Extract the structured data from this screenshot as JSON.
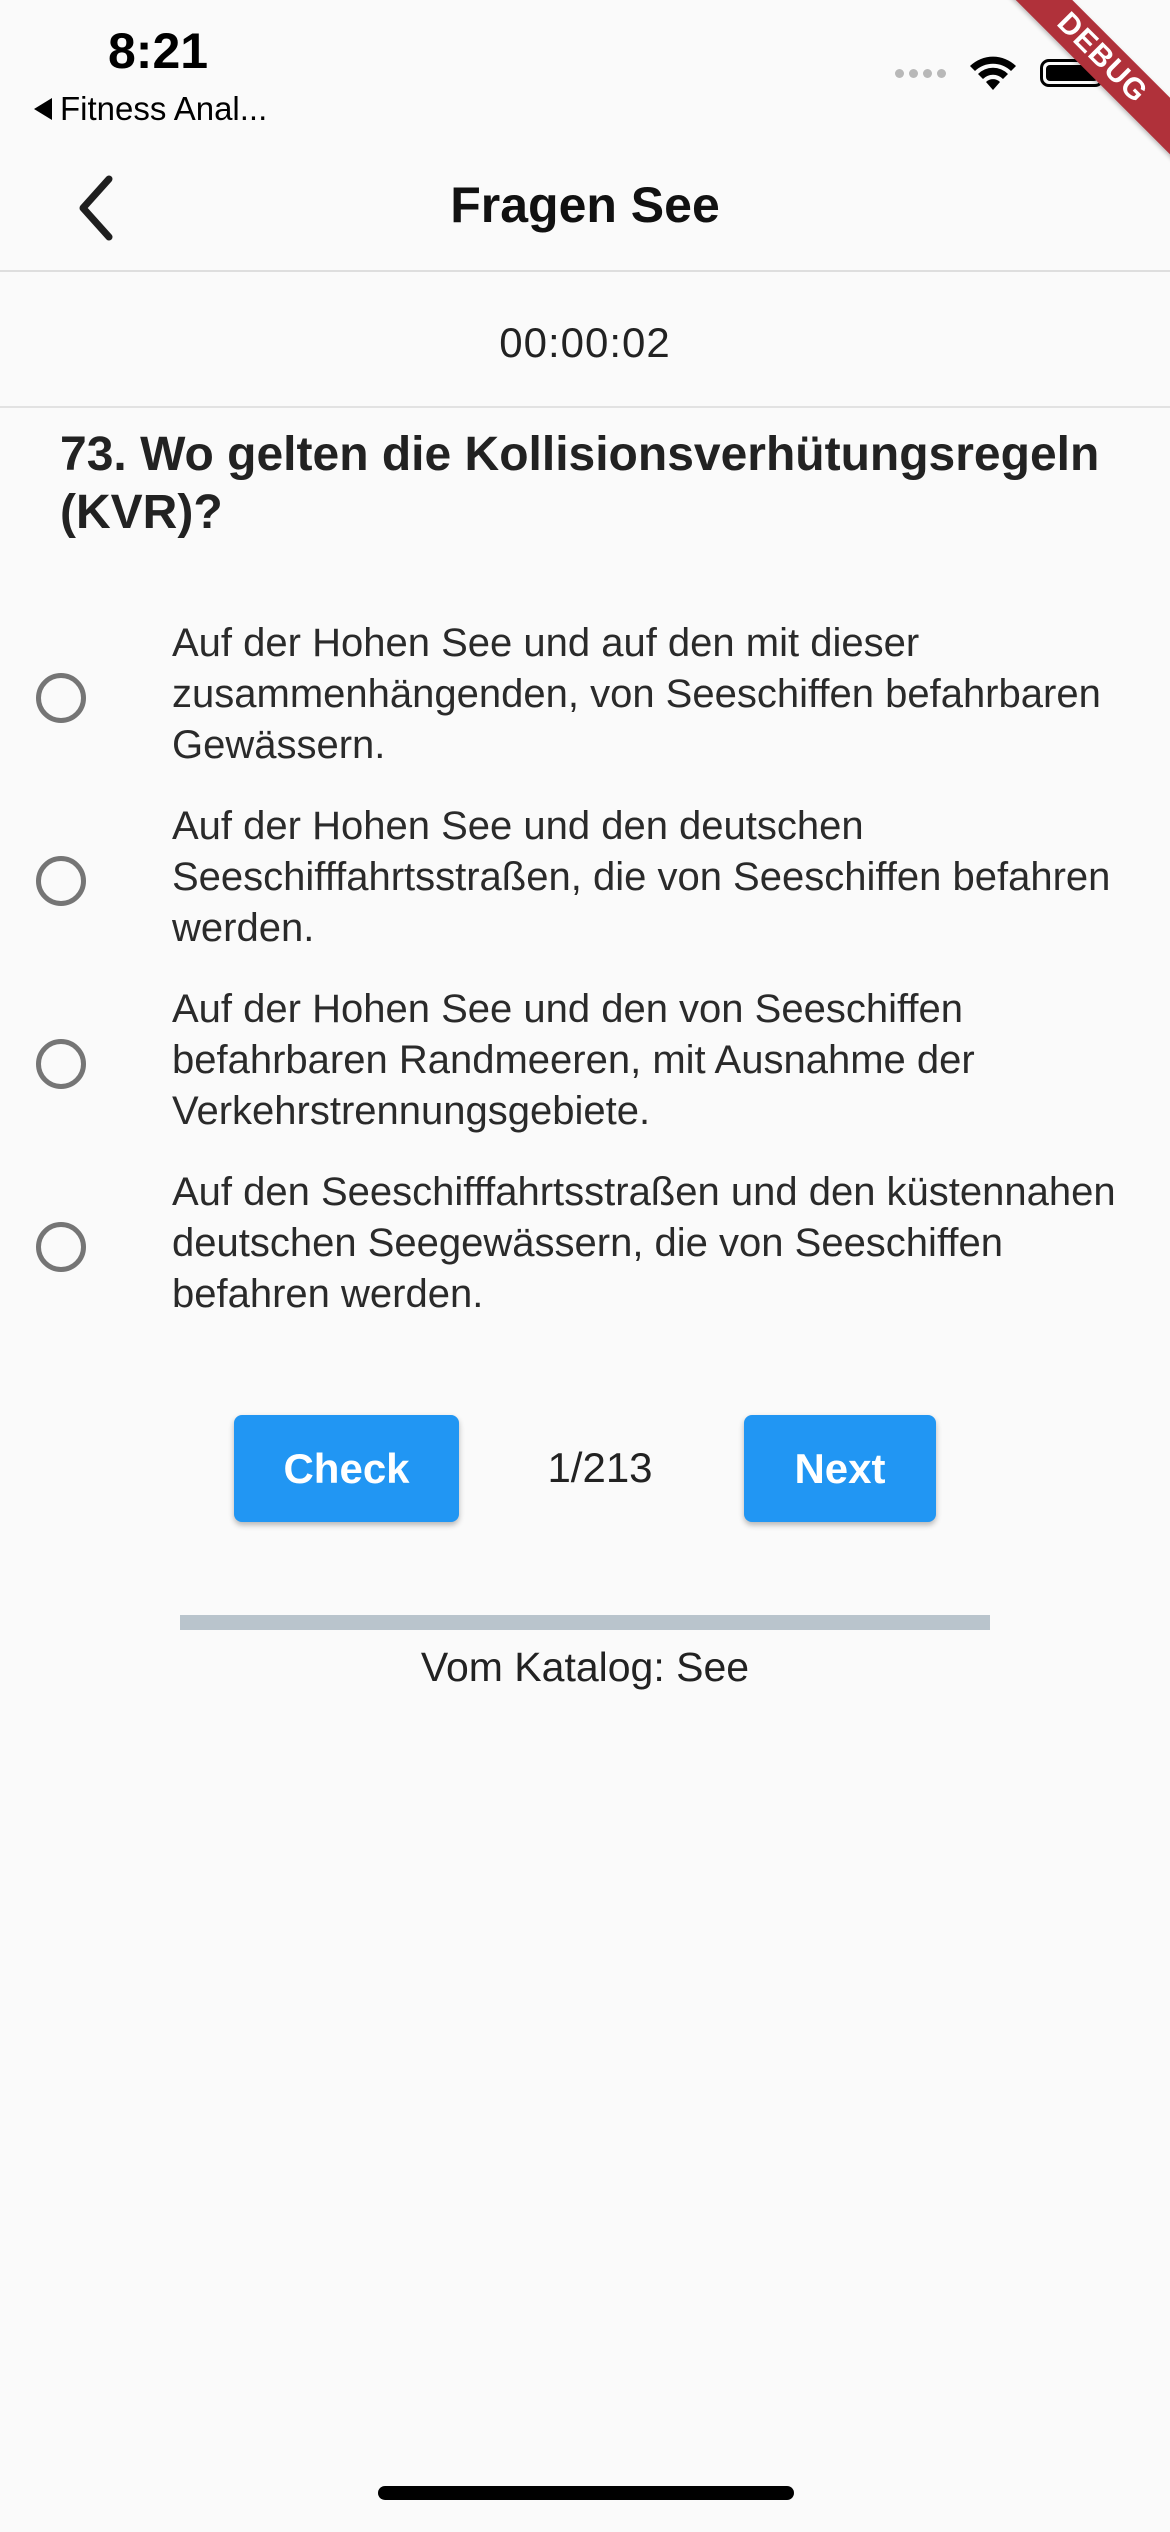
{
  "status_bar": {
    "time": "8:21",
    "back_app": "Fitness Anal...",
    "icons": [
      "signal-dots-icon",
      "wifi-icon",
      "battery-icon"
    ]
  },
  "debug_banner": "DEBUG",
  "app_bar": {
    "title": "Fragen See",
    "back_icon": "chevron-left-icon"
  },
  "timer": "00:00:02",
  "question": {
    "text": "73. Wo gelten die Kollisionsverhütungsregeln (KVR)?"
  },
  "answers": [
    {
      "text": "Auf der Hohen See und auf den mit dieser zusammenhängenden, von Seeschiffen befahrbaren Gewässern.",
      "selected": false
    },
    {
      "text": "Auf der Hohen See und den deutschen Seeschifffahrtsstraßen, die von Seeschiffen befahren werden.",
      "selected": false
    },
    {
      "text": "Auf der Hohen See und den von Seeschiffen befahrbaren Randmeeren, mit Ausnahme der Verkehrstrennungsgebiete.",
      "selected": false
    },
    {
      "text": "Auf den Seeschifffahrtsstraßen und den küstennahen deutschen Seegewässern, die von Seeschiffen befahren werden.",
      "selected": false
    }
  ],
  "controls": {
    "check_label": "Check",
    "next_label": "Next",
    "counter": "1/213"
  },
  "progress": {
    "value": 0.0
  },
  "catalog_label": "Vom Katalog: See",
  "colors": {
    "accent": "#2196f3",
    "debug": "#b0313a",
    "progress_track": "#b9c4cc"
  }
}
